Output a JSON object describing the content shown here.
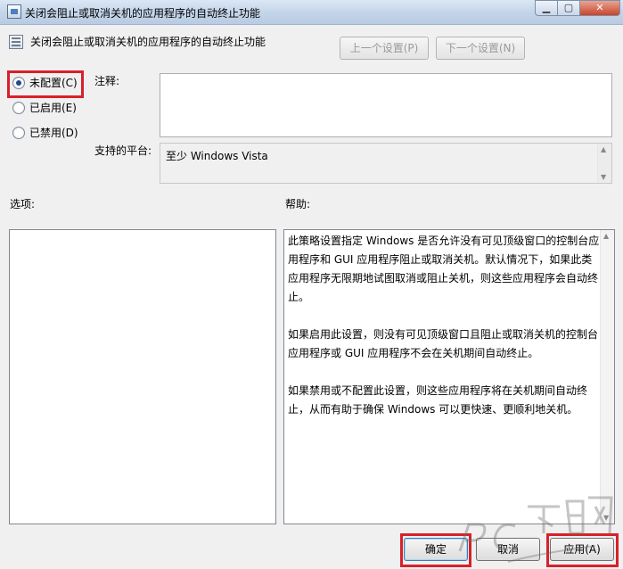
{
  "window": {
    "title": "关闭会阻止或取消关机的应用程序的自动终止功能",
    "minimize_glyph": "▁",
    "maximize_glyph": "▢",
    "close_glyph": "✕"
  },
  "setting": {
    "title": "关闭会阻止或取消关机的应用程序的自动终止功能",
    "prev_label": "上一个设置(P)",
    "next_label": "下一个设置(N)"
  },
  "state": {
    "options": [
      {
        "label": "未配置(C)",
        "selected": true
      },
      {
        "label": "已启用(E)",
        "selected": false
      },
      {
        "label": "已禁用(D)",
        "selected": false
      }
    ]
  },
  "comment": {
    "label": "注释:",
    "value": ""
  },
  "platform": {
    "label": "支持的平台:",
    "value": "至少 Windows Vista"
  },
  "options_pane": {
    "label": "选项:"
  },
  "help": {
    "label": "帮助:",
    "paragraphs": [
      "此策略设置指定 Windows 是否允许没有可见顶级窗口的控制台应用程序和 GUI 应用程序阻止或取消关机。默认情况下，如果此类应用程序无限期地试图取消或阻止关机，则这些应用程序会自动终止。",
      "如果启用此设置，则没有可见顶级窗口且阻止或取消关机的控制台应用程序或 GUI 应用程序不会在关机期间自动终止。",
      "如果禁用或不配置此设置，则这些应用程序将在关机期间自动终止，从而有助于确保 Windows 可以更快速、更顺利地关机。"
    ]
  },
  "buttons": {
    "ok": "确定",
    "cancel": "取消",
    "apply": "应用(A)"
  },
  "colors": {
    "highlight": "#d9202a",
    "radio_dot": "#22488a"
  },
  "icons": {
    "app": "policy-app-icon",
    "setting": "policy-setting-icon",
    "watermark": "pc-download-watermark-logo"
  }
}
